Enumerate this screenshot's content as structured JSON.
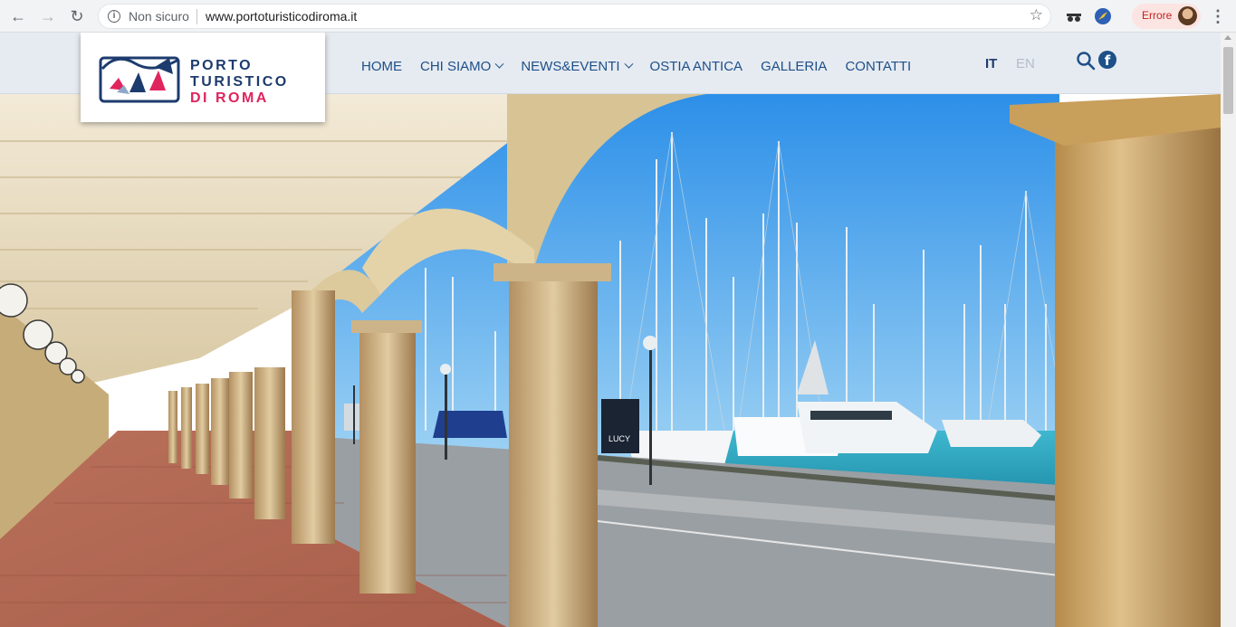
{
  "browser": {
    "back_icon": "arrow-left-icon",
    "forward_icon": "arrow-right-icon",
    "reload_icon": "reload-icon",
    "security_label": "Non sicuro",
    "url": "www.portoturisticodiroma.it",
    "error_label": "Errore"
  },
  "site": {
    "logo": {
      "line1": "PORTO",
      "line2": "TURISTICO",
      "line3": "DI ROMA"
    },
    "nav": [
      {
        "label": "HOME",
        "dropdown": false
      },
      {
        "label": "CHI SIAMO",
        "dropdown": true
      },
      {
        "label": "NEWS&EVENTI",
        "dropdown": true
      },
      {
        "label": "OSTIA ANTICA",
        "dropdown": false
      },
      {
        "label": "GALLERIA",
        "dropdown": false
      },
      {
        "label": "CONTATTI",
        "dropdown": false
      }
    ],
    "languages": {
      "active": "IT",
      "other": "EN"
    },
    "colors": {
      "brand_blue": "#1d3b6e",
      "brand_pink": "#e0245e",
      "nav_blue": "#1d4f88"
    }
  },
  "hero": {
    "description": "Marina portico with travertine columns and arches overlooking a harbour with sailboats"
  }
}
